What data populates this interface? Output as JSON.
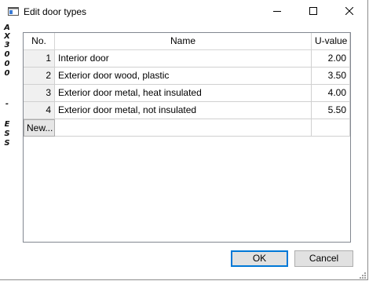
{
  "window": {
    "title": "Edit door types",
    "icon": "window-app-icon",
    "controls": {
      "minimize": "minimize-icon",
      "maximize": "maximize-icon",
      "close": "close-icon"
    }
  },
  "brand_strip": {
    "chars": [
      "A",
      "X",
      "3",
      "0",
      "0",
      "0",
      "",
      "-",
      "",
      "E",
      "S",
      "S"
    ]
  },
  "grid": {
    "columns": [
      "No.",
      "Name",
      "U-value"
    ],
    "rows": [
      {
        "no": "1",
        "name": "Interior door",
        "u_value": "2.00"
      },
      {
        "no": "2",
        "name": "Exterior door wood, plastic",
        "u_value": "3.50"
      },
      {
        "no": "3",
        "name": "Exterior door metal, heat insulated",
        "u_value": "4.00"
      },
      {
        "no": "4",
        "name": "Exterior door metal, not insulated",
        "u_value": "5.50"
      }
    ],
    "new_row_label": "New..."
  },
  "buttons": {
    "ok": "OK",
    "cancel": "Cancel"
  },
  "colors": {
    "accent": "#0078d7",
    "row_header": "#f0f0f0",
    "button_face": "#e1e1e1"
  }
}
